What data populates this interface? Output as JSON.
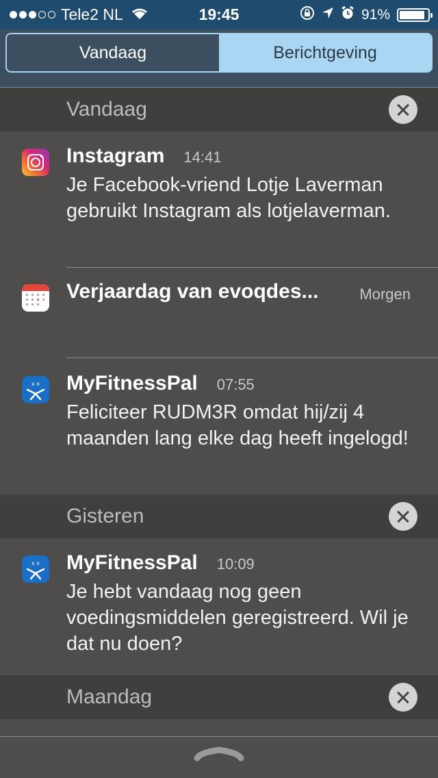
{
  "status_bar": {
    "carrier": "Tele2 NL",
    "time": "19:45",
    "battery": "91%",
    "battery_level": 0.91,
    "icons": [
      "signal-dots",
      "wifi-icon",
      "rotation-lock-icon",
      "location-icon",
      "alarm-icon",
      "battery-icon"
    ]
  },
  "tabs": [
    {
      "label": "Vandaag",
      "selected": false
    },
    {
      "label": "Berichtgeving",
      "selected": true
    }
  ],
  "sections": [
    {
      "title": "Vandaag",
      "notifications": [
        {
          "app": "Instagram",
          "icon": "instagram-icon",
          "time": "14:41",
          "body": "Je Facebook-vriend Lotje Laverman gebruikt Instagram als lotjelaverman."
        },
        {
          "app": "Verjaardag van evoqdes...",
          "icon": "calendar-icon",
          "time": "Morgen",
          "body": ""
        },
        {
          "app": "MyFitnessPal",
          "icon": "myfitnesspal-icon",
          "time": "07:55",
          "body": "Feliciteer RUDM3R omdat hij/zij 4 maanden lang elke dag heeft ingelogd!"
        }
      ]
    },
    {
      "title": "Gisteren",
      "notifications": [
        {
          "app": "MyFitnessPal",
          "icon": "myfitnesspal-icon",
          "time": "10:09",
          "body": "Je hebt vandaag nog geen voedingsmiddelen geregistreerd. Wil je dat nu doen?"
        }
      ]
    },
    {
      "title": "Maandag",
      "notifications": []
    }
  ],
  "colors": {
    "status_bar_bg": "#1f4b6e",
    "segment_active": "#a9d6f2",
    "myfitnesspal_blue": "#1a6ec6",
    "calendar_red": "#e5463c"
  }
}
